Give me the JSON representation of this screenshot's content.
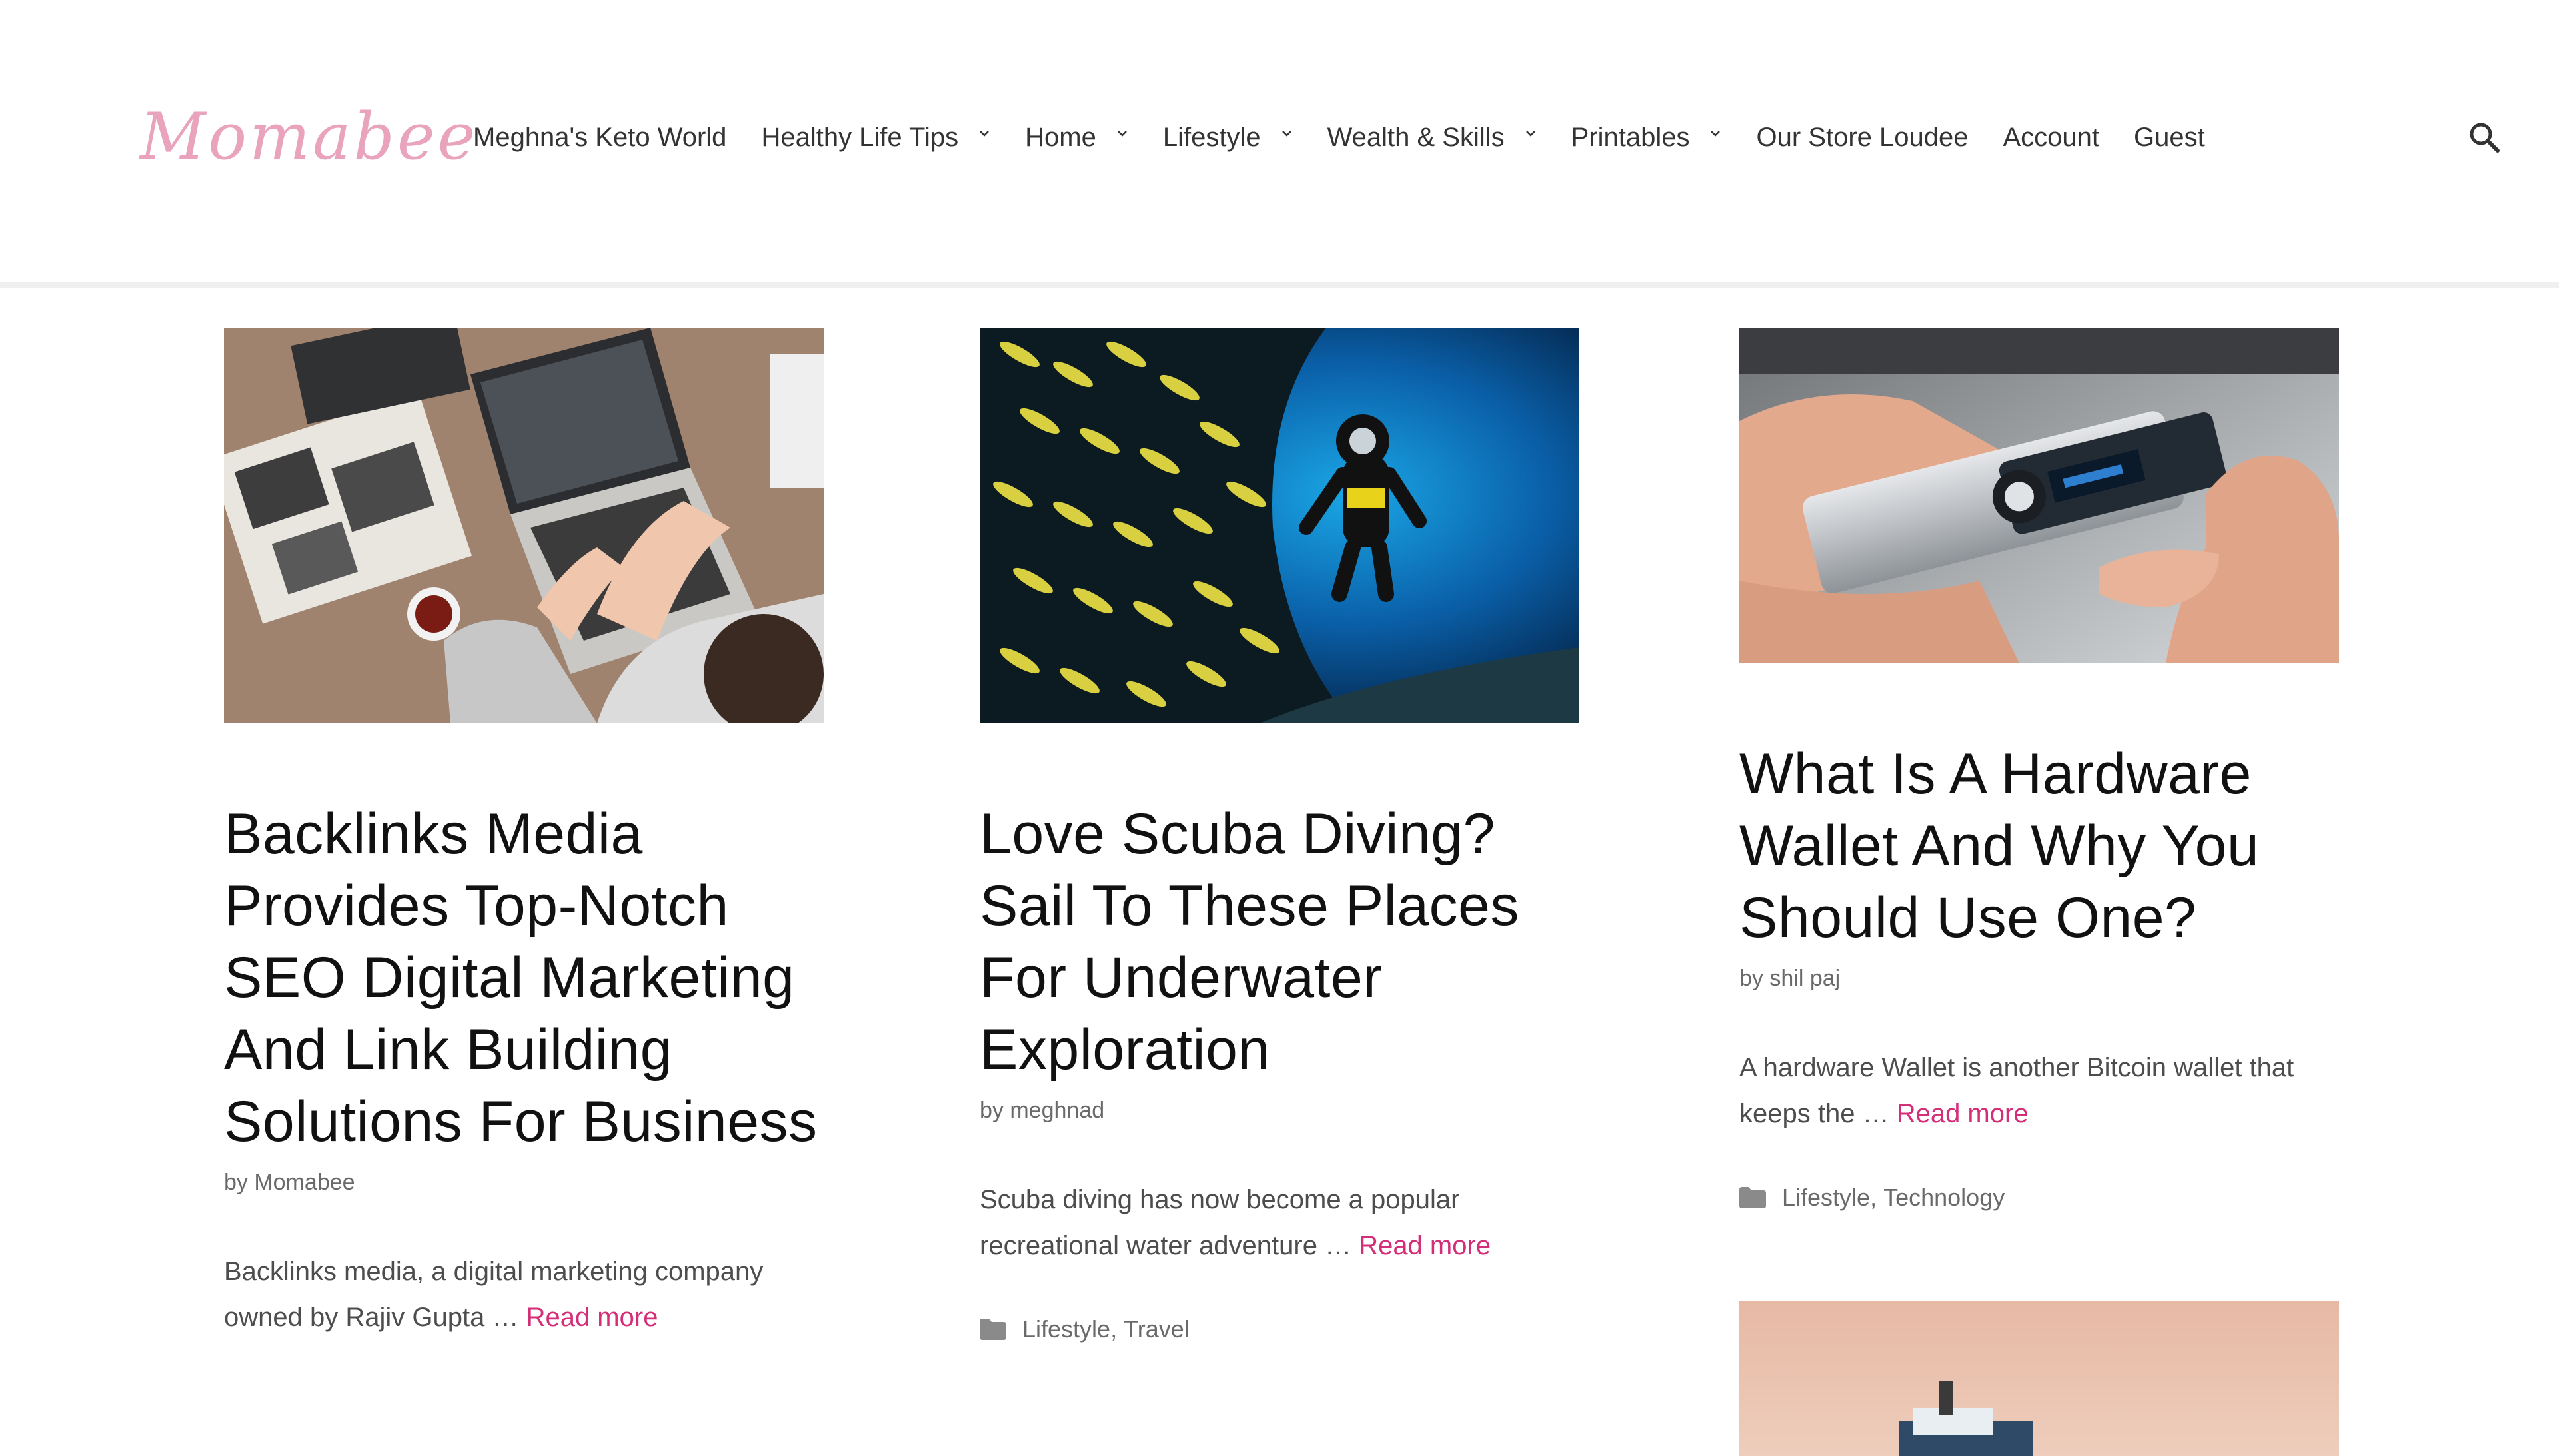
{
  "site": {
    "logo_text": "Momabee",
    "brand_color": "#e9a3bd",
    "accent_color": "#d42e79"
  },
  "nav": {
    "items": [
      {
        "label": "Meghna's Keto World",
        "has_dropdown": false
      },
      {
        "label": "Healthy Life Tips",
        "has_dropdown": true
      },
      {
        "label": "Home",
        "has_dropdown": true
      },
      {
        "label": "Lifestyle",
        "has_dropdown": true
      },
      {
        "label": "Wealth & Skills",
        "has_dropdown": true
      },
      {
        "label": "Printables",
        "has_dropdown": true
      },
      {
        "label": "Our Store Loudee",
        "has_dropdown": false
      },
      {
        "label": "Account",
        "has_dropdown": false
      },
      {
        "label": "Guest",
        "has_dropdown": false
      }
    ],
    "search_icon": "search-icon"
  },
  "posts": [
    {
      "image_subject": "laptop-workspace-photo",
      "title": "Backlinks Media Provides Top-Notch SEO Digital Marketing And Link Building Solutions For Business",
      "author": "by Momabee",
      "excerpt": "Backlinks media, a digital marketing company owned by Rajiv Gupta … ",
      "read_more": "Read more",
      "categories": []
    },
    {
      "image_subject": "scuba-diver-photo",
      "title": "Love Scuba Diving? Sail To These Places For Underwater Exploration",
      "author": "by meghnad",
      "excerpt": "Scuba diving has now become a popular recreational water adventure … ",
      "read_more": "Read more",
      "categories": [
        "Lifestyle",
        "Travel"
      ]
    },
    {
      "image_subject": "hardware-wallet-photo",
      "title": "What Is A Hardware Wallet And Why You Should Use One?",
      "author": "by shil paj",
      "excerpt": "A hardware Wallet is another Bitcoin wallet that keeps the … ",
      "read_more": "Read more",
      "categories": [
        "Lifestyle",
        "Technology"
      ]
    },
    {
      "image_subject": "boat-photo"
    }
  ]
}
